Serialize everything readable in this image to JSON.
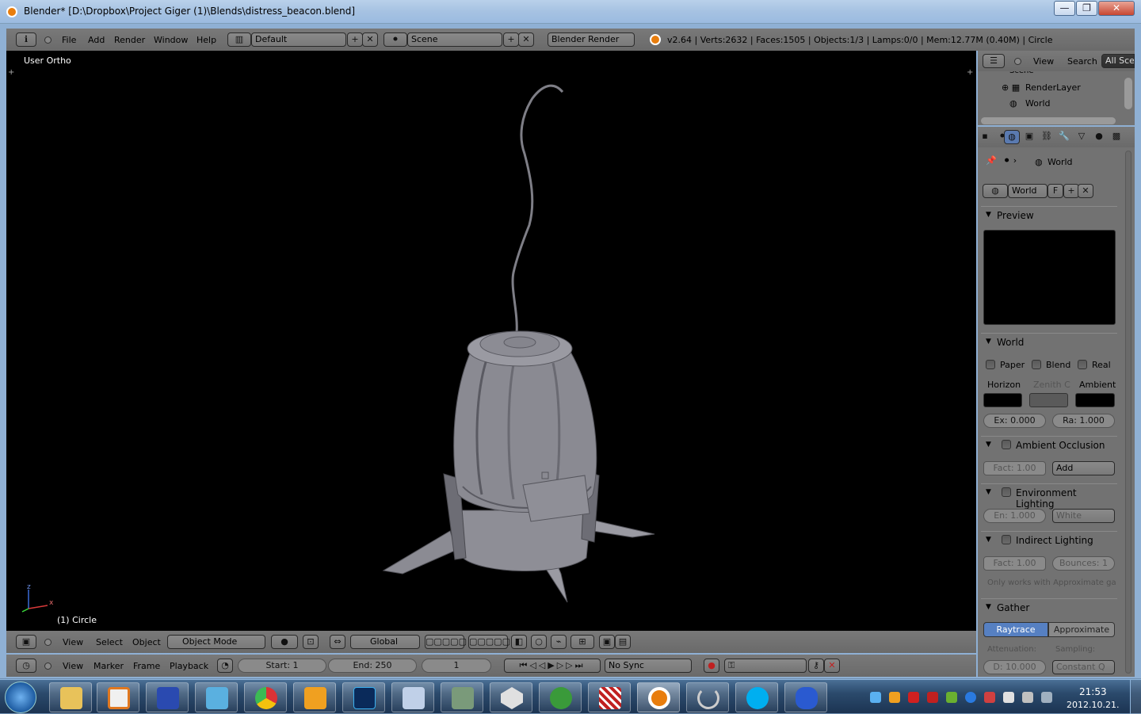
{
  "window": {
    "title": "Blender* [D:\\Dropbox\\Project Giger (1)\\Blends\\distress_beacon.blend]",
    "minimize": "—",
    "maximize": "❐",
    "close": "✕"
  },
  "info_header": {
    "menus": [
      "File",
      "Add",
      "Render",
      "Window",
      "Help"
    ],
    "screen_layout": "Default",
    "scene": "Scene",
    "render_engine": "Blender Render",
    "stats": "v2.64 | Verts:2632 | Faces:1505 | Objects:1/3 | Lamps:0/0 | Mem:12.77M (0.40M) | Circle"
  },
  "viewport": {
    "view_name": "User Ortho",
    "object_label": "(1) Circle",
    "axis_x": "x",
    "axis_z": "z"
  },
  "view3d_header": {
    "menus": [
      "View",
      "Select",
      "Object"
    ],
    "mode": "Object Mode",
    "orientation": "Global"
  },
  "outliner": {
    "menus": [
      "View",
      "Search"
    ],
    "filter": "All Scen",
    "items": [
      "Scene",
      "RenderLayer",
      "World"
    ]
  },
  "properties": {
    "breadcrumb": "World",
    "world_name": "World",
    "fake_user": "F",
    "preview_heading": "Preview",
    "world_heading": "World",
    "checkboxes": [
      "Paper",
      "Blend",
      "Real"
    ],
    "color_labels": [
      "Horizon",
      "Zenith C",
      "Ambient"
    ],
    "exposure": "Ex: 0.000",
    "range": "Ra: 1.000",
    "ao_heading": "Ambient Occlusion",
    "ao_factor": "Fact: 1.00",
    "ao_blend": "Add",
    "env_heading": "Environment Lighting",
    "env_energy": "En: 1.000",
    "env_color": "White",
    "indirect_heading": "Indirect Lighting",
    "indirect_factor": "Fact: 1.00",
    "indirect_bounces": "Bounces: 1",
    "indirect_note": "Only works with Approximate ga",
    "gather_heading": "Gather",
    "gather_modes": [
      "Raytrace",
      "Approximate"
    ],
    "attenuation_label": "Attenuation:",
    "sampling_label": "Sampling:",
    "distance": "D: 10.000",
    "sampling_method": "Constant Q"
  },
  "timeline": {
    "menus": [
      "View",
      "Marker",
      "Frame",
      "Playback"
    ],
    "start": "Start: 1",
    "end": "End: 250",
    "current_frame": "1",
    "sync": "No Sync"
  },
  "taskbar": {
    "time": "21:53",
    "date": "2012.10.21."
  },
  "colors": {
    "blender_orange": "#e87d0d",
    "panel_gray": "#727272",
    "viewport_bg": "#000000",
    "mesh_gray": "#8a8a92",
    "gather_selected": "#5680c2"
  }
}
